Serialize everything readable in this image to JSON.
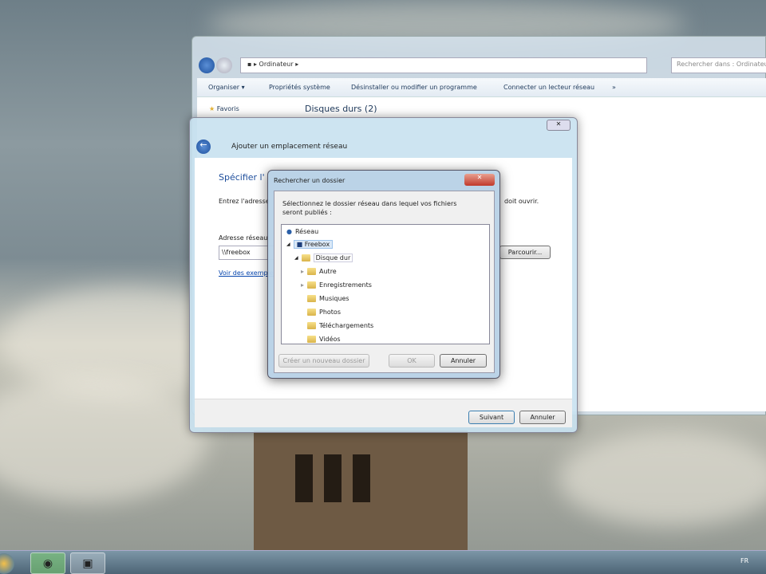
{
  "explorer": {
    "breadcrumb": "Ordinateur",
    "search_placeholder": "Rechercher dans : Ordinateur",
    "toolbar": [
      "Organiser ▾",
      "Propriétés système",
      "Désinstaller ou modifier un programme",
      "Connecter un lecteur réseau",
      "»"
    ],
    "favorites": "Favoris",
    "section": "Disques durs (2)"
  },
  "wizard": {
    "title": "Ajouter un emplacement réseau",
    "heading": "Spécifier l'",
    "instruction": "Entrez l'adresse",
    "instruction_end": "doit ouvrir.",
    "address_label": "Adresse réseau",
    "address_value": "\\\\freebox",
    "browse_button": "Parcourir...",
    "examples_link": "Voir des exemples",
    "next_button": "Suivant",
    "cancel_button": "Annuler"
  },
  "browse": {
    "title": "Rechercher un dossier",
    "description": "Sélectionnez le dossier réseau dans lequel vos fichiers seront publiés :",
    "tree": {
      "root": "Réseau",
      "host": "Freebox",
      "drive": "Disque dur",
      "folders": [
        "Autre",
        "Enregistrements",
        "Musiques",
        "Photos",
        "Téléchargements",
        "Vidéos"
      ]
    },
    "new_folder_button": "Créer un nouveau dossier",
    "ok_button": "OK",
    "cancel_button": "Annuler"
  },
  "taskbar": {
    "language": "FR"
  }
}
